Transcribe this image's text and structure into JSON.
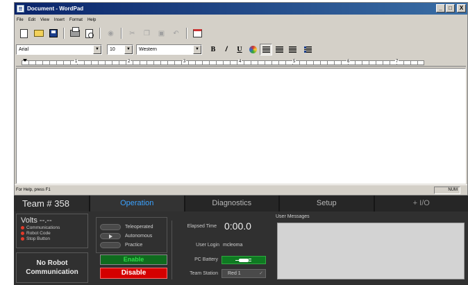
{
  "wordpad": {
    "title": "Document - WordPad",
    "window_buttons": {
      "minimize": "_",
      "maximize": "□",
      "close": "X"
    },
    "menu": [
      "File",
      "Edit",
      "View",
      "Insert",
      "Format",
      "Help"
    ],
    "toolbar_icons": [
      "new-icon",
      "open-icon",
      "save-icon",
      "print-icon",
      "print-preview-icon",
      "find-icon",
      "cut-icon",
      "copy-icon",
      "paste-icon",
      "undo-icon",
      "date-time-icon"
    ],
    "font": "Arial",
    "size": "10",
    "script": "Western",
    "format_buttons": {
      "bold": "B",
      "italic": "/",
      "underline": "U"
    },
    "ruler_numbers": [
      "1",
      "2",
      "3",
      "4",
      "5",
      "6",
      "7"
    ],
    "status_text": "For Help, press F1",
    "status_panel": "NUM"
  },
  "driver_station": {
    "team": "Team # 358",
    "tabs": [
      "Operation",
      "Diagnostics",
      "Setup",
      "+ I/O"
    ],
    "active_tab": "Operation",
    "volts": "Volts  --.--",
    "indicators": [
      "Communications",
      "Robot Code",
      "Stop Button"
    ],
    "no_robot": [
      "No Robot",
      "Communication"
    ],
    "modes": [
      "Teleoperated",
      "Autonomous",
      "Practice"
    ],
    "selected_mode": "Autonomous",
    "enable": "Enable",
    "disable": "Disable",
    "elapsed_label": "Elapsed Time",
    "elapsed_value": "0:00.0",
    "login_label": "User Login",
    "login_value": "mcleoma",
    "battery_label": "PC Battery",
    "station_label": "Team Station",
    "station_value": "Red 1",
    "messages_label": "User Messages",
    "colors": {
      "accent": "#3ba2ff",
      "enable": "#0f6b1e",
      "disable": "#d40000",
      "indicator": "#e23b2a"
    }
  }
}
